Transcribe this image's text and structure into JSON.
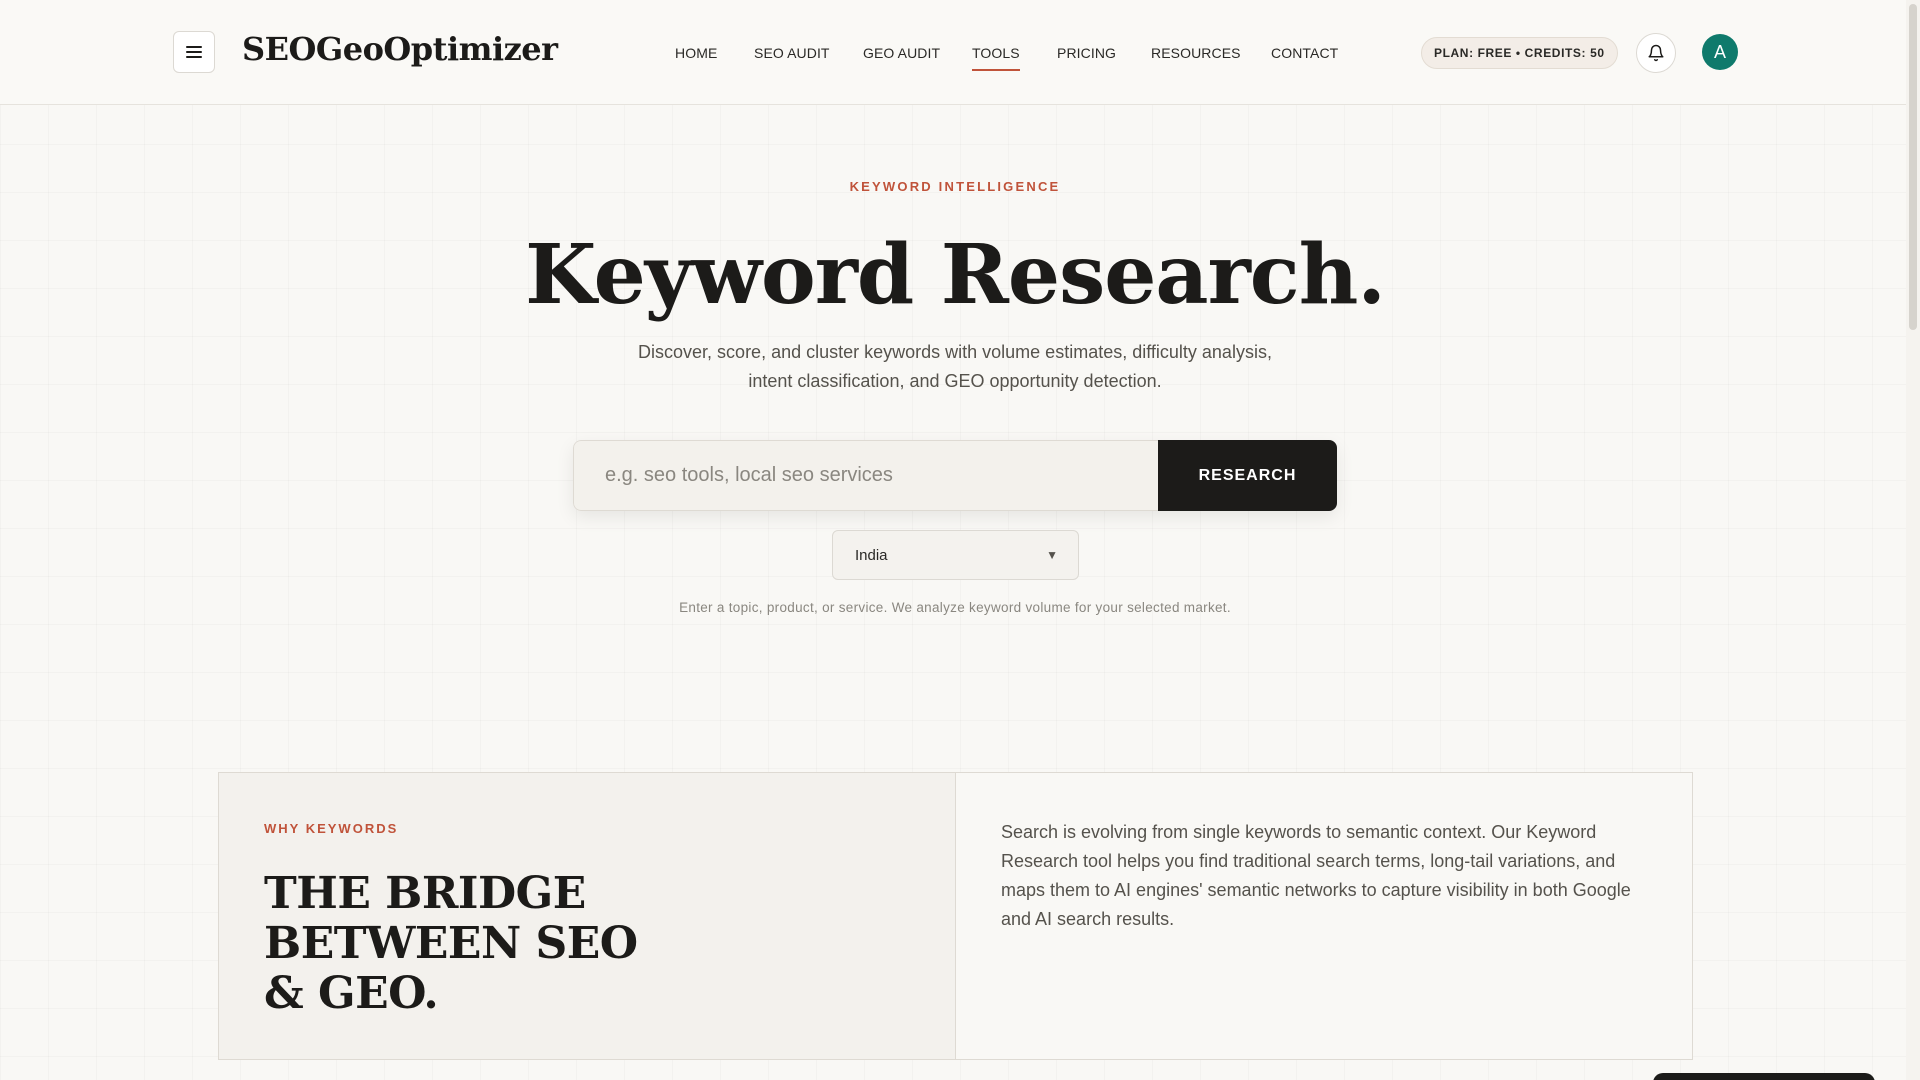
{
  "header": {
    "logo": "SEOGeoOptimizer",
    "nav": [
      {
        "label": "HOME",
        "active": false
      },
      {
        "label": "SEO AUDIT",
        "active": false
      },
      {
        "label": "GEO AUDIT",
        "active": false
      },
      {
        "label": "TOOLS",
        "active": true
      },
      {
        "label": "PRICING",
        "active": false
      },
      {
        "label": "RESOURCES",
        "active": false
      },
      {
        "label": "CONTACT",
        "active": false
      }
    ],
    "plan_badge": "PLAN: FREE • CREDITS: 50",
    "avatar_initial": "A",
    "icons": {
      "menu": "hamburger-menu-icon",
      "notifications": "bell-icon"
    }
  },
  "hero": {
    "eyebrow": "KEYWORD INTELLIGENCE",
    "title": "Keyword Research.",
    "subtitle": "Discover, score, and cluster keywords with volume estimates, difficulty analysis, intent classification, and GEO opportunity detection."
  },
  "search": {
    "placeholder": "e.g. seo tools, local seo services",
    "value": "",
    "button_label": "RESEARCH",
    "country": "India",
    "helper": "Enter a topic, product, or service. We analyze keyword volume for your selected market."
  },
  "why": {
    "eyebrow": "WHY KEYWORDS",
    "title": "THE BRIDGE BETWEEN SEO & GEO.",
    "body": "Search is evolving from single keywords to semantic context. Our Keyword Research tool helps you find traditional search terms, long-tail variations, and maps them to AI engines' semantic networks to capture visibility in both Google and AI search results."
  },
  "colors": {
    "accent": "#c0533a",
    "dark": "#1c1b19",
    "avatar": "#0f7a6c",
    "background": "#f9f8f5"
  }
}
